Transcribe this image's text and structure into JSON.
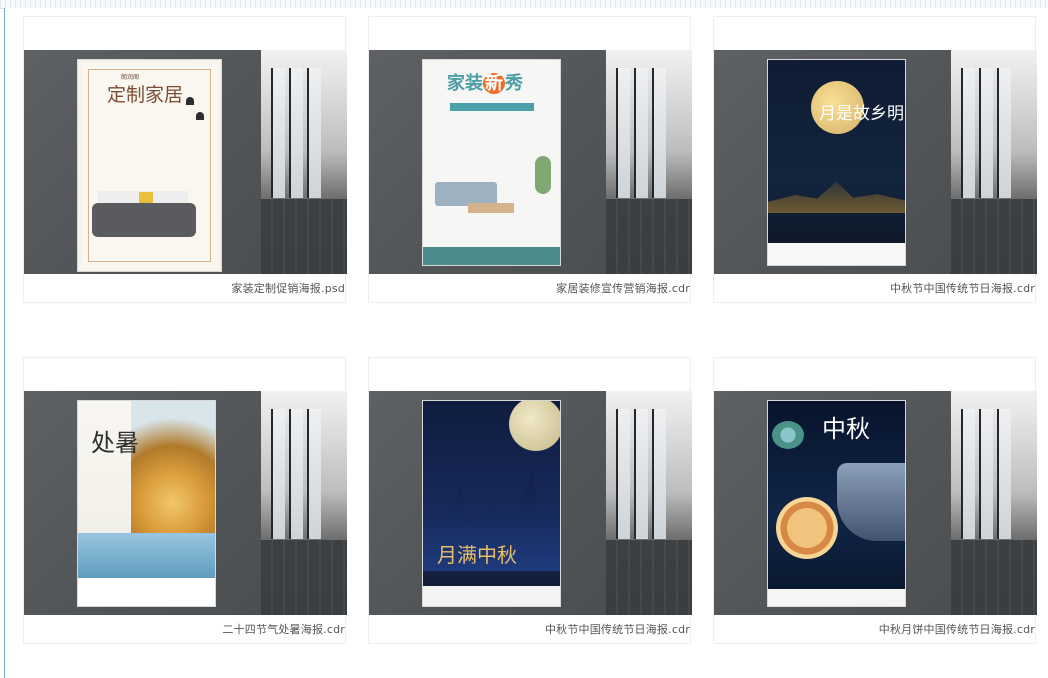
{
  "gallery": {
    "items": [
      {
        "caption": "家装定制促销海报.psd",
        "poster": {
          "brand": "朗润阁",
          "title": "定制家居"
        }
      },
      {
        "caption": "家居装修宣传营销海报.cdr",
        "poster": {
          "title_prefix": "家装",
          "title_highlight": "新",
          "title_suffix": "秀"
        }
      },
      {
        "caption": "中秋节中国传统节日海报.cdr",
        "poster": {
          "title": "月是故乡明"
        }
      },
      {
        "caption": "二十四节气处暑海报.cdr",
        "poster": {
          "title": "处暑"
        }
      },
      {
        "caption": "中秋节中国传统节日海报.cdr",
        "poster": {
          "title": "月满中秋"
        }
      },
      {
        "caption": "中秋月饼中国传统节日海报.cdr",
        "poster": {
          "title": "中秋"
        }
      }
    ]
  }
}
